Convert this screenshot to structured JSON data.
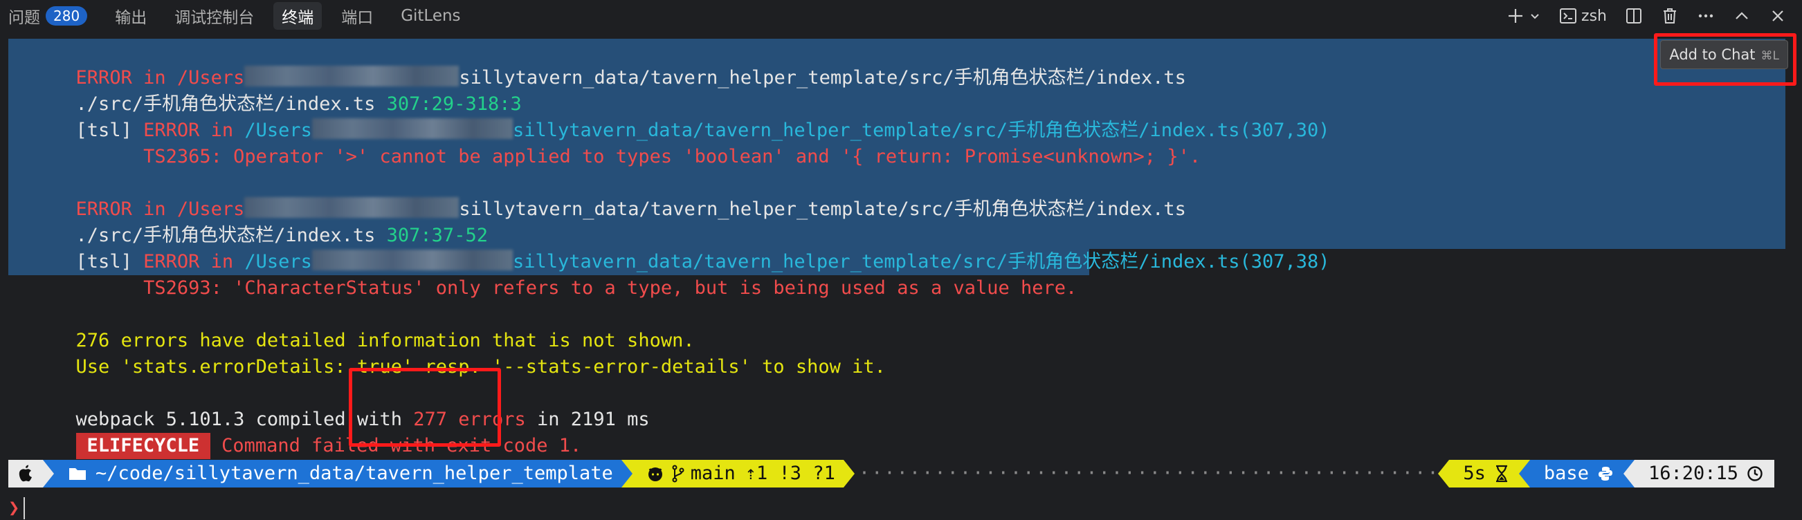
{
  "tabs": [
    {
      "label": "问题",
      "badge": "280"
    },
    {
      "label": "输出"
    },
    {
      "label": "调试控制台"
    },
    {
      "label": "终端"
    },
    {
      "label": "端口"
    },
    {
      "label": "GitLens"
    }
  ],
  "toolbar": {
    "shell_label": "zsh"
  },
  "add_to_chat": {
    "label": "Add to Chat",
    "shortcut": "⌘L"
  },
  "terminal": {
    "e1_l1_a": "ERROR in /Users",
    "e1_l1_b": "sillytavern_data/tavern_helper_template/src/手机角色状态栏/index.ts",
    "e1_l2_a": "./src/手机角色状态栏/index.ts",
    "e1_l2_b": "307:29-318:3",
    "e1_l3_a": "[tsl]",
    "e1_l3_b": "ERROR in",
    "e1_l3_c": "/Users",
    "e1_l3_d": "sillytavern_data/tavern_helper_template/src/手机角色状态栏/index.ts(307,30)",
    "e1_l4": "      TS2365: Operator '>' cannot be applied to types 'boolean' and '{ return: Promise<unknown>; }'.",
    "e2_l1_a": "ERROR in /Users",
    "e2_l1_b": "sillytavern_data/tavern_helper_template/src/手机角色状态栏/index.ts",
    "e2_l2_a": "./src/手机角色状态栏/index.ts",
    "e2_l2_b": "307:37-52",
    "e2_l3_a": "[tsl]",
    "e2_l3_b": "ERROR in",
    "e2_l3_c": "/Users",
    "e2_l3_d": "sillytavern_data/tavern_helper_template/src/手机角色状态栏/index.ts(307,38)",
    "e2_l4": "      TS2693: 'CharacterStatus' only refers to a type, but is being used as a value here.",
    "summary1": "276 errors have detailed information that is not shown.",
    "summary2": "Use 'stats.errorDetails: true' resp. '--stats-error-details' to show it.",
    "compiled_a": "webpack 5.101.3 compiled with ",
    "compiled_b": "277 errors",
    "compiled_c": " in 2191 ms",
    "elifecycle": "ELIFECYCLE",
    "failed": "Command failed with exit code 1."
  },
  "prompt": {
    "path": "~/code/sillytavern_data/tavern_helper_template",
    "branch": "main",
    "git_status": "⇡1 !3 ?1",
    "duration": "5s",
    "env": "base",
    "time": "16:20:15",
    "symbol": "❯"
  },
  "colors": {
    "selection": "#264f78",
    "error_red": "#f14c4c",
    "path_cyan": "#29b8db",
    "warn_yellow": "#e5e510",
    "green": "#23d18b",
    "segment_blue": "#1e73d6",
    "highlight_box": "#ff1a1a"
  }
}
